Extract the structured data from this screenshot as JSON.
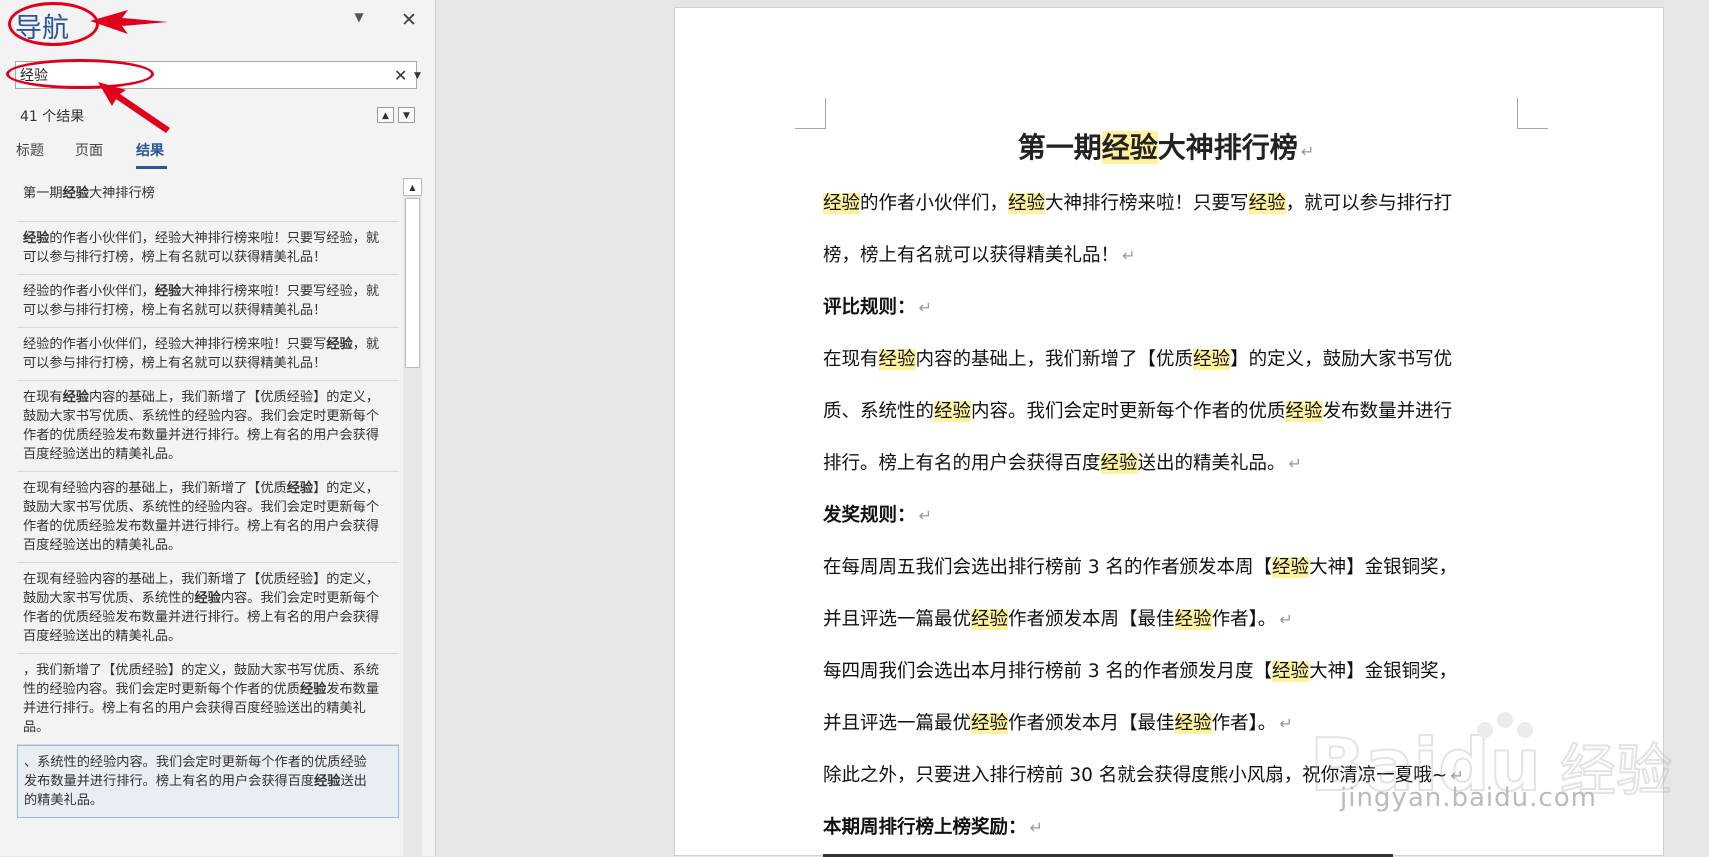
{
  "nav": {
    "title": "导航",
    "search_value": "经验",
    "search_clear_glyph": "✕",
    "search_dropdown_glyph": "▼",
    "options_glyph": "▼",
    "close_glyph": "✕",
    "result_count": "41 个结果",
    "prev_glyph": "▲",
    "next_glyph": "▼",
    "tabs": [
      "标题",
      "页面",
      "结果"
    ],
    "active_tab": "结果",
    "results": [
      {
        "parts": [
          [
            "第一期",
            false
          ],
          [
            "经验",
            true
          ],
          [
            "大神排行榜",
            false
          ]
        ]
      },
      {
        "parts": [
          [
            "经验",
            true
          ],
          [
            "的作者小伙伴们，经验大神排行榜来啦！只要写经验，就可以参与排行打榜，榜上有名就可以获得精美礼品！",
            false
          ]
        ]
      },
      {
        "parts": [
          [
            "经验的作者小伙伴们，",
            false
          ],
          [
            "经验",
            true
          ],
          [
            "大神排行榜来啦！只要写经验，就可以参与排行打榜，榜上有名就可以获得精美礼品！",
            false
          ]
        ]
      },
      {
        "parts": [
          [
            "经验的作者小伙伴们，经验大神排行榜来啦！只要写",
            false
          ],
          [
            "经验",
            true
          ],
          [
            "，就可以参与排行打榜，榜上有名就可以获得精美礼品！",
            false
          ]
        ]
      },
      {
        "parts": [
          [
            "在现有",
            false
          ],
          [
            "经验",
            true
          ],
          [
            "内容的基础上，我们新增了【优质经验】的定义，鼓励大家书写优质、系统性的经验内容。我们会定时更新每个作者的优质经验发布数量并进行排行。榜上有名的用户会获得百度经验送出的精美礼品。",
            false
          ]
        ]
      },
      {
        "parts": [
          [
            "在现有经验内容的基础上，我们新增了【优质",
            false
          ],
          [
            "经验",
            true
          ],
          [
            "】的定义，鼓励大家书写优质、系统性的经验内容。我们会定时更新每个作者的优质经验发布数量并进行排行。榜上有名的用户会获得百度经验送出的精美礼品。",
            false
          ]
        ]
      },
      {
        "parts": [
          [
            "在现有经验内容的基础上，我们新增了【优质经验】的定义，鼓励大家书写优质、系统性的",
            false
          ],
          [
            "经验",
            true
          ],
          [
            "内容。我们会定时更新每个作者的优质经验发布数量并进行排行。榜上有名的用户会获得百度经验送出的精美礼品。",
            false
          ]
        ]
      },
      {
        "parts": [
          [
            "，我们新增了【优质经验】的定义，鼓励大家书写优质、系统性的经验内容。我们会定时更新每个作者的优质",
            false
          ],
          [
            "经验",
            true
          ],
          [
            "发布数量并进行排行。榜上有名的用户会获得百度经验送出的精美礼品。",
            false
          ]
        ]
      },
      {
        "parts": [
          [
            "、系统性的经验内容。我们会定时更新每个作者的优质经验发布数量并进行排行。榜上有名的用户会获得百度",
            false
          ],
          [
            "经验",
            true
          ],
          [
            "送出的精美礼品。",
            false
          ]
        ]
      }
    ]
  },
  "doc": {
    "title_parts": [
      [
        "第一期",
        false
      ],
      [
        "经验",
        true
      ],
      [
        "大神排行榜",
        false
      ]
    ],
    "paragraph_mark": "↵",
    "paragraphs": [
      {
        "bold": false,
        "parts": [
          [
            "经验",
            true
          ],
          [
            "的作者小伙伴们，",
            false
          ],
          [
            "经验",
            true
          ],
          [
            "大神排行榜来啦！只要写",
            false
          ],
          [
            "经验",
            true
          ],
          [
            "，就可以参与排行打",
            false
          ]
        ],
        "mark": false
      },
      {
        "bold": false,
        "parts": [
          [
            "榜，榜上有名就可以获得精美礼品！",
            false
          ]
        ],
        "mark": true
      },
      {
        "bold": true,
        "parts": [
          [
            "评比规则：",
            false
          ]
        ],
        "mark": true
      },
      {
        "bold": false,
        "parts": [
          [
            "在现有",
            false
          ],
          [
            "经验",
            true
          ],
          [
            "内容的基础上，我们新增了【优质",
            false
          ],
          [
            "经验",
            true
          ],
          [
            "】的定义，鼓励大家书写优",
            false
          ]
        ],
        "mark": false
      },
      {
        "bold": false,
        "parts": [
          [
            "质、系统性的",
            false
          ],
          [
            "经验",
            true
          ],
          [
            "内容。我们会定时更新每个作者的优质",
            false
          ],
          [
            "经验",
            true
          ],
          [
            "发布数量并进行",
            false
          ]
        ],
        "mark": false
      },
      {
        "bold": false,
        "parts": [
          [
            "排行。榜上有名的用户会获得百度",
            false
          ],
          [
            "经验",
            true
          ],
          [
            "送出的精美礼品。",
            false
          ]
        ],
        "mark": true
      },
      {
        "bold": true,
        "parts": [
          [
            "发奖规则：",
            false
          ]
        ],
        "mark": true
      },
      {
        "bold": false,
        "parts": [
          [
            "在每周周五我们会选出排行榜前 3 名的作者颁发本周【",
            false
          ],
          [
            "经验",
            true
          ],
          [
            "大神】金银铜奖，",
            false
          ]
        ],
        "mark": false
      },
      {
        "bold": false,
        "parts": [
          [
            "并且评选一篇最优",
            false
          ],
          [
            "经验",
            true
          ],
          [
            "作者颁发本周【最佳",
            false
          ],
          [
            "经验",
            true
          ],
          [
            "作者】。",
            false
          ]
        ],
        "mark": true
      },
      {
        "bold": false,
        "parts": [
          [
            "每四周我们会选出本月排行榜前 3 名的作者颁发月度【",
            false
          ],
          [
            "经验",
            true
          ],
          [
            "大神】金银铜奖，",
            false
          ]
        ],
        "mark": false
      },
      {
        "bold": false,
        "parts": [
          [
            "并且评选一篇最优",
            false
          ],
          [
            "经验",
            true
          ],
          [
            "作者颁发本月【最佳",
            false
          ],
          [
            "经验",
            true
          ],
          [
            "作者】。",
            false
          ]
        ],
        "mark": true
      },
      {
        "bold": false,
        "parts": [
          [
            "除此之外，只要进入排行榜前 30 名就会获得度熊小风扇，祝你清凉一夏哦~",
            false
          ]
        ],
        "mark": true
      },
      {
        "bold": true,
        "parts": [
          [
            "本期周排行榜上榜奖励：",
            false
          ]
        ],
        "mark": true
      }
    ]
  },
  "watermark": {
    "brand_text": "Baidu",
    "brand_suffix": "经验",
    "url": "jingyan.baidu.com"
  },
  "colors": {
    "accent": "#2b579a",
    "highlight": "#fff29c",
    "annotation_red": "#e0001b"
  }
}
